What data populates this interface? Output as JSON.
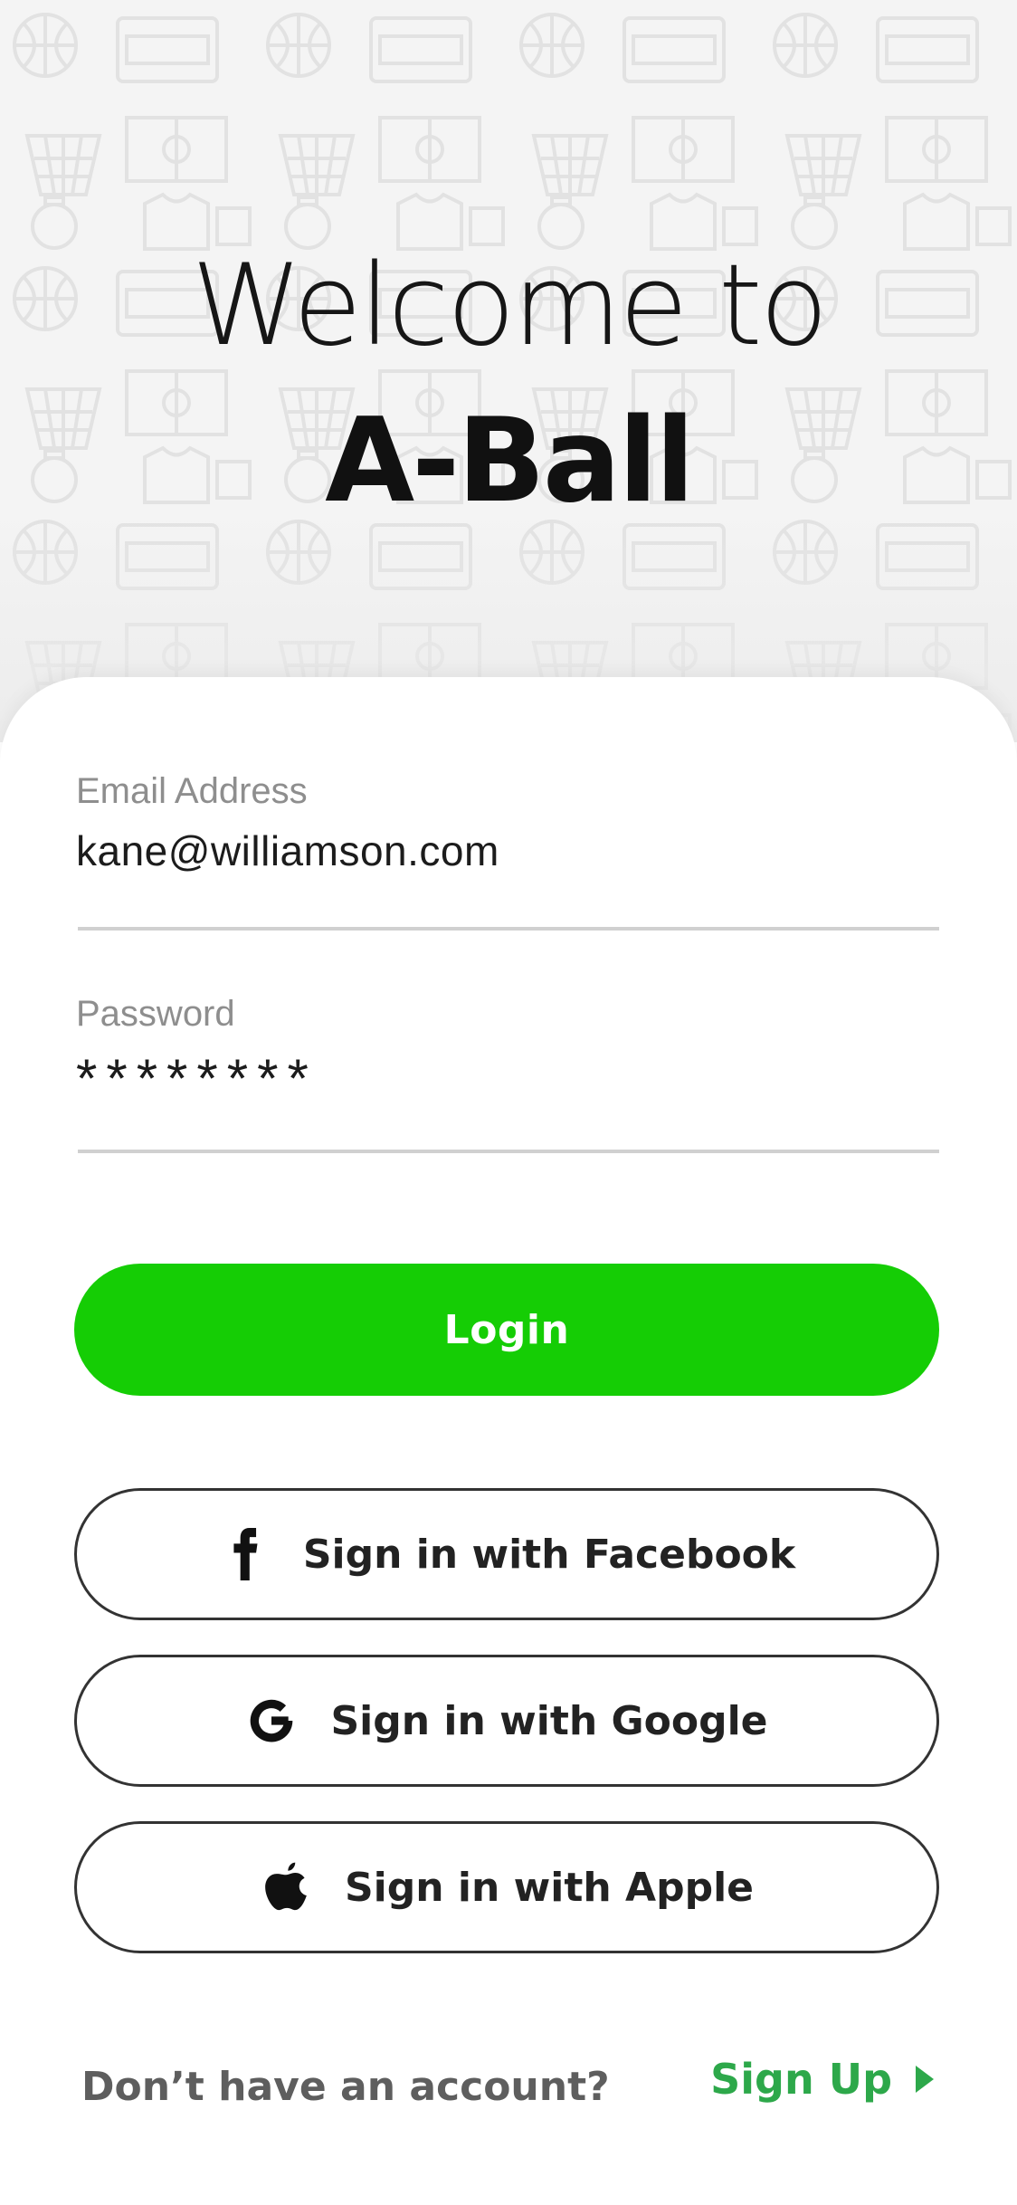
{
  "hero": {
    "welcome_line": "Welcome to",
    "brand_name": "A-Ball"
  },
  "form": {
    "email": {
      "label": "Email Address",
      "value": "kane@williamson.com"
    },
    "password": {
      "label": "Password",
      "value": "********"
    }
  },
  "buttons": {
    "login": "Login",
    "facebook": "Sign in with Facebook",
    "google": "Sign in with Google",
    "apple": "Sign in with Apple"
  },
  "footer": {
    "prompt": "Don’t have an account?",
    "signup": "Sign Up"
  },
  "colors": {
    "accent_green": "#15cd05",
    "link_green": "#2da84a"
  },
  "icons": [
    "facebook-icon",
    "google-icon",
    "apple-icon",
    "triangle-right-icon"
  ]
}
